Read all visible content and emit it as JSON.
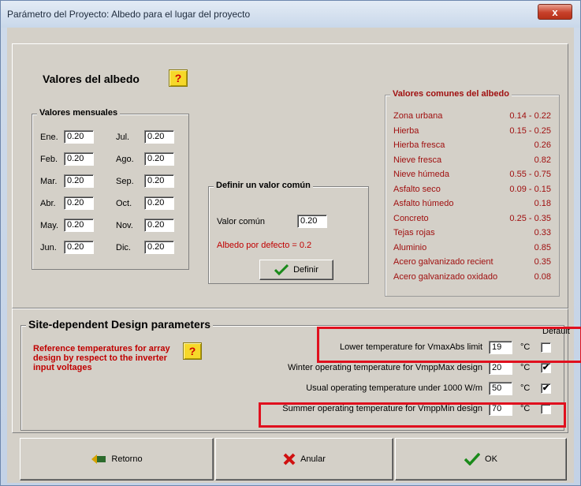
{
  "window": {
    "title": "Parámetro del Proyecto: Albedo para el lugar del proyecto",
    "close_label": "x"
  },
  "albedo": {
    "heading": "Valores del albedo",
    "help": "?",
    "monthly": {
      "title": "Valores mensuales",
      "left": [
        {
          "label": "Ene.",
          "value": "0.20"
        },
        {
          "label": "Feb.",
          "value": "0.20"
        },
        {
          "label": "Mar.",
          "value": "0.20"
        },
        {
          "label": "Abr.",
          "value": "0.20"
        },
        {
          "label": "May.",
          "value": "0.20"
        },
        {
          "label": "Jun.",
          "value": "0.20"
        }
      ],
      "right": [
        {
          "label": "Jul.",
          "value": "0.20"
        },
        {
          "label": "Ago.",
          "value": "0.20"
        },
        {
          "label": "Sep.",
          "value": "0.20"
        },
        {
          "label": "Oct.",
          "value": "0.20"
        },
        {
          "label": "Nov.",
          "value": "0.20"
        },
        {
          "label": "Dic.",
          "value": "0.20"
        }
      ]
    },
    "common": {
      "title": "Definir un valor común",
      "field_label": "Valor común",
      "field_value": "0.20",
      "default_note": "Albedo por defecto = 0.2",
      "define_button": "Definir"
    },
    "reference": {
      "title": "Valores comunes del albedo",
      "rows": [
        {
          "name": "Zona urbana",
          "value": "0.14 - 0.22"
        },
        {
          "name": "Hierba",
          "value": "0.15 - 0.25"
        },
        {
          "name": "Hierba fresca",
          "value": "0.26"
        },
        {
          "name": "Nieve fresca",
          "value": "0.82"
        },
        {
          "name": "Nieve húmeda",
          "value": "0.55 - 0.75"
        },
        {
          "name": "Asfalto seco",
          "value": "0.09 - 0.15"
        },
        {
          "name": "Asfalto húmedo",
          "value": "0.18"
        },
        {
          "name": "Concreto",
          "value": "0.25 - 0.35"
        },
        {
          "name": "Tejas rojas",
          "value": "0.33"
        },
        {
          "name": "Aluminio",
          "value": "0.85"
        },
        {
          "name": "Acero galvanizado recient",
          "value": "0.35"
        },
        {
          "name": "Acero galvanizado oxidado",
          "value": "0.08"
        }
      ]
    }
  },
  "design": {
    "title": "Site-dependent Design parameters",
    "note": "Reference temperatures for array design by respect to the inverter input voltages",
    "help": "?",
    "default_label": "Default",
    "unit": "°C",
    "rows": [
      {
        "label": "Lower temperature for VmaxAbs limit",
        "value": "19",
        "default_checked": false
      },
      {
        "label": "Winter operating temperature for VmppMax design",
        "value": "20",
        "default_checked": true
      },
      {
        "label": "Usual operating temperature under 1000 W/m",
        "value": "50",
        "default_checked": true
      },
      {
        "label": "Summer operating temperature for VmppMin design",
        "value": "70",
        "default_checked": false
      }
    ]
  },
  "buttons": {
    "back": "Retorno",
    "cancel": "Anular",
    "ok": "OK"
  },
  "colors": {
    "highlight": "#e0101e",
    "help_bg": "#f6d82a",
    "reference_text": "#a01010"
  },
  "icons": {
    "check": "check-icon",
    "cross": "cross-icon",
    "back": "back-arrow-icon"
  }
}
